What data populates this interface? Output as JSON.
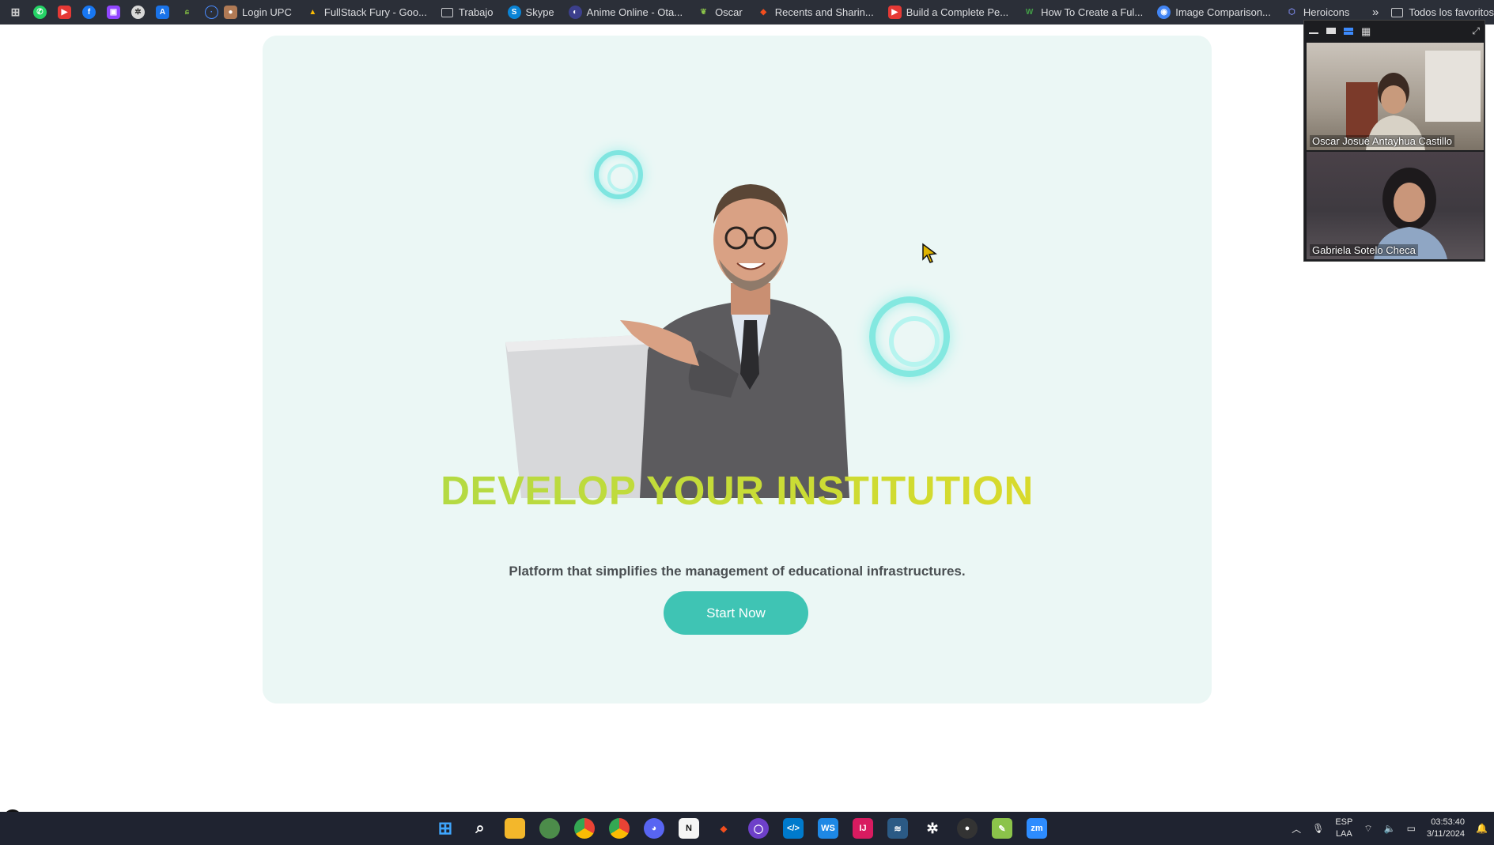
{
  "bookmarks": {
    "items": [
      {
        "label": "Login UPC",
        "icon": "person-icon",
        "color": "#b07a55"
      },
      {
        "label": "FullStack Fury - Goo...",
        "icon": "google-drive-icon",
        "color": "#1fa463"
      },
      {
        "label": "Trabajo",
        "icon": "folder-icon",
        "color": ""
      },
      {
        "label": "Skype",
        "icon": "skype-icon",
        "color": "#0a84d6"
      },
      {
        "label": "Anime Online - Ota...",
        "icon": "anime-icon",
        "color": "#3c3f8c"
      },
      {
        "label": "Oscar",
        "icon": "leaf-icon",
        "color": "#7cb342"
      },
      {
        "label": "Recents and Sharin...",
        "icon": "figma-icon",
        "color": "#f24e1e"
      },
      {
        "label": "Build a Complete Pe...",
        "icon": "youtube-icon",
        "color": "#e53935"
      },
      {
        "label": "How To Create a Ful...",
        "icon": "w-icon",
        "color": "#2e7d32"
      },
      {
        "label": "Image Comparison...",
        "icon": "chrome-site-icon",
        "color": "#4285f4"
      },
      {
        "label": "Heroicons",
        "icon": "shield-icon",
        "color": "#5a67d8"
      }
    ],
    "all_bookmarks_label": "Todos los favoritos"
  },
  "hero": {
    "title": "DEVELOP YOUR INSTITUTION",
    "subtitle": "Platform that simplifies the management of educational infrastructures.",
    "cta_label": "Start Now"
  },
  "video_panel": {
    "participants": [
      {
        "name": "Oscar Josué Antayhua Castillo"
      },
      {
        "name": "Gabriela Sotelo Checa"
      }
    ]
  },
  "taskbar": {
    "lang": "ESP",
    "lang_sub": "LAA",
    "time": "03:53:40",
    "date": "3/11/2024"
  },
  "colors": {
    "hero_bg": "#ebf7f5",
    "cta": "#3fc4b4",
    "title_gradient_start": "#a8d84a",
    "title_gradient_end": "#e3d924"
  }
}
